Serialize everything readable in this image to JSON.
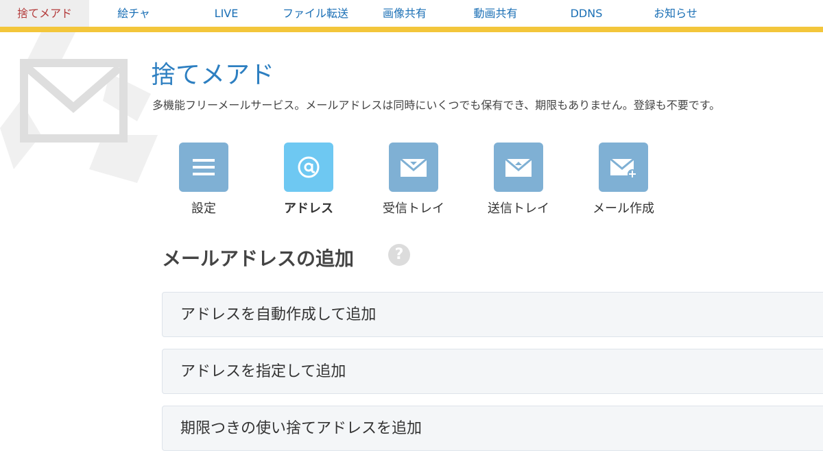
{
  "nav": {
    "items": [
      {
        "label": "捨てメアド",
        "active": true
      },
      {
        "label": "絵チャ"
      },
      {
        "label": "LIVE"
      },
      {
        "label": "ファイル転送"
      },
      {
        "label": "画像共有"
      },
      {
        "label": "動画共有"
      },
      {
        "label": "DDNS"
      },
      {
        "label": "お知らせ"
      }
    ]
  },
  "header": {
    "title": "捨てメアド",
    "description": "多機能フリーメールサービス。メールアドレスは同時にいくつでも保有でき、期限もありません。登録も不要です。"
  },
  "menu": {
    "items": [
      {
        "label": "設定",
        "icon": "menu-lines-icon"
      },
      {
        "label": "アドレス",
        "icon": "at-sign-icon",
        "active": true
      },
      {
        "label": "受信トレイ",
        "icon": "inbox-envelope-icon"
      },
      {
        "label": "送信トレイ",
        "icon": "sent-envelope-icon"
      },
      {
        "label": "メール作成",
        "icon": "compose-envelope-icon"
      }
    ]
  },
  "section": {
    "title": "メールアドレスの追加",
    "help": "?"
  },
  "options": [
    {
      "label": "アドレスを自動作成して追加"
    },
    {
      "label": "アドレスを指定して追加"
    },
    {
      "label": "期限つきの使い捨てアドレスを追加"
    }
  ],
  "colors": {
    "accent_bar": "#f3c63b",
    "title": "#2d7fc1",
    "tile": "#7fb0d4",
    "tile_active": "#6ec8f2"
  }
}
